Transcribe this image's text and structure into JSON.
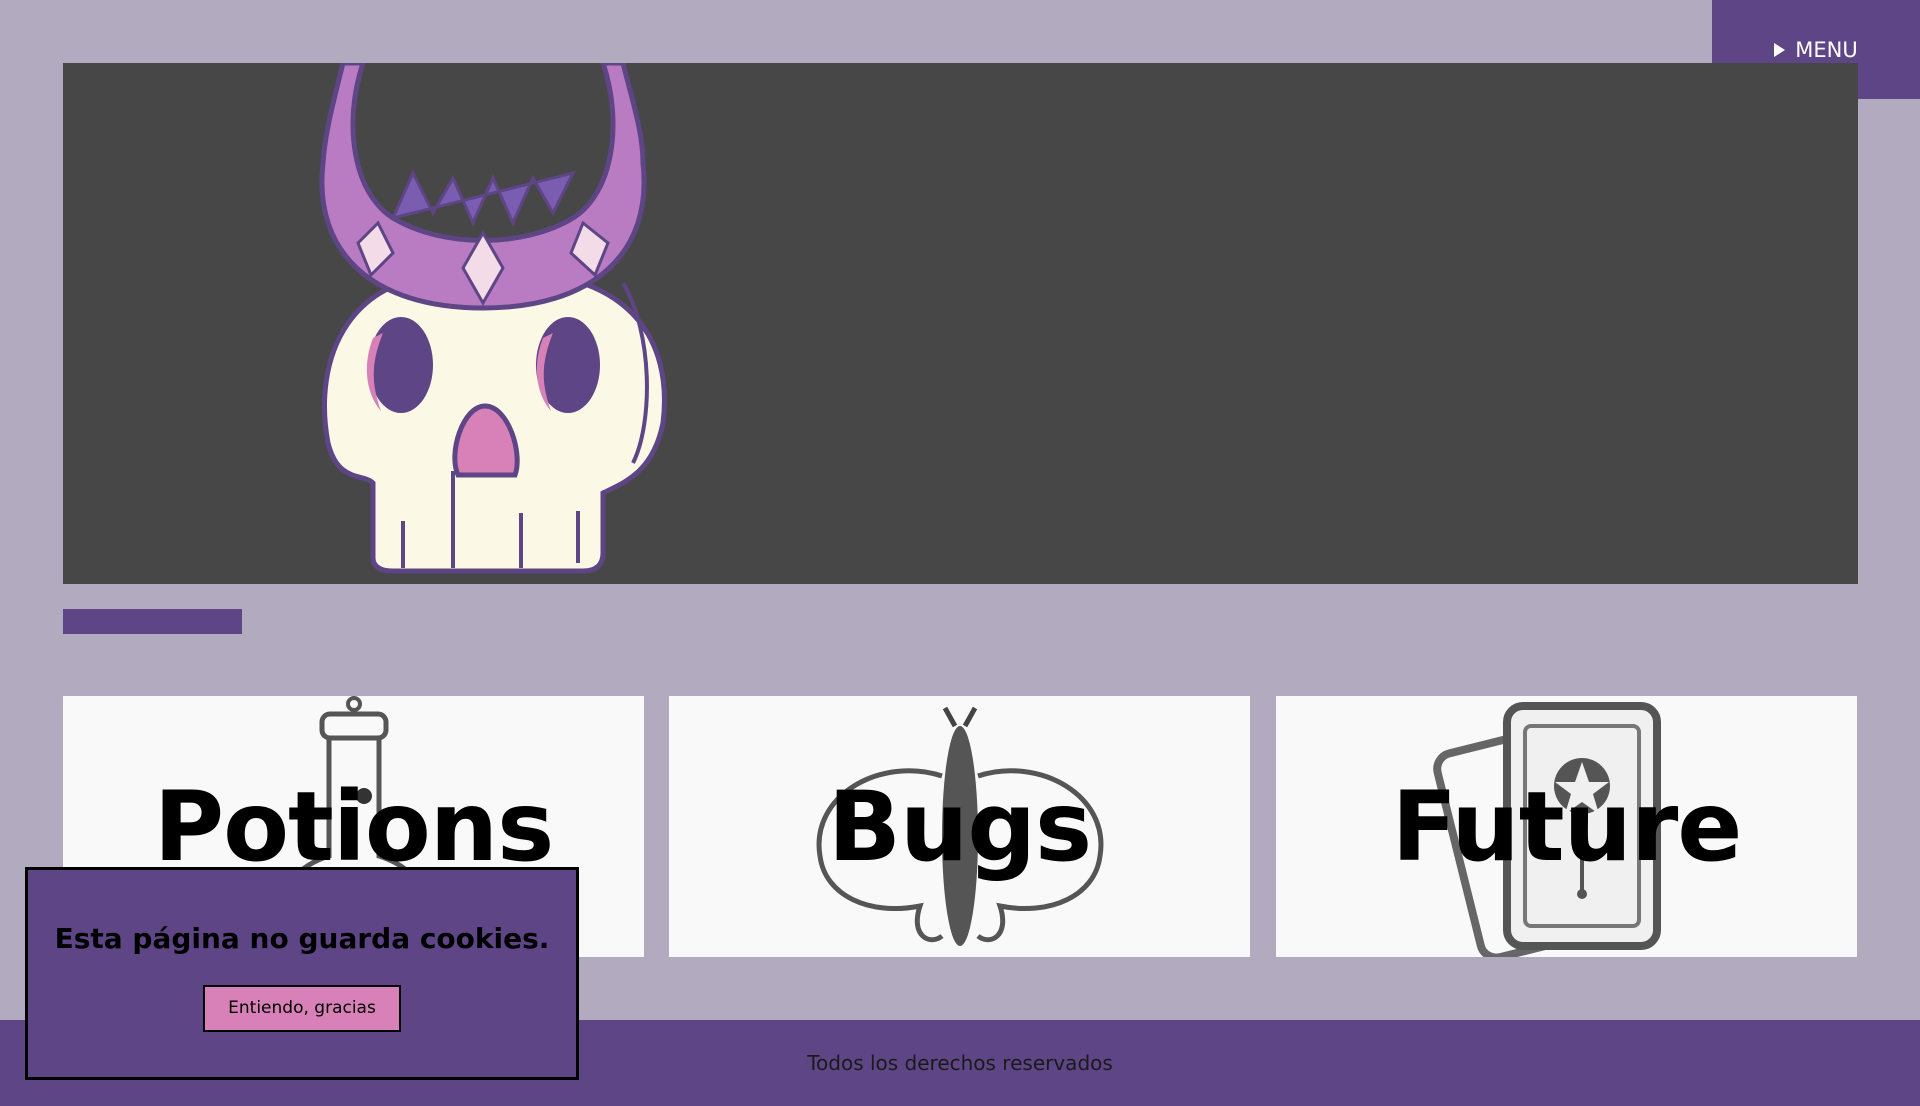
{
  "menu": {
    "label": "MENU",
    "icon": "play-triangle-icon"
  },
  "hero": {
    "image": "crowned-skull-illustration"
  },
  "cards": [
    {
      "title": "Potions",
      "icon": "potion-bottle-icon"
    },
    {
      "title": "Bugs",
      "icon": "moth-icon"
    },
    {
      "title": "Future",
      "icon": "tarot-cards-icon"
    }
  ],
  "cookie_banner": {
    "message": "Esta página no guarda cookies.",
    "button_label": "Entiendo, gracias"
  },
  "footer": {
    "text": "Todos los derechos reservados"
  },
  "colors": {
    "background": "#b2abbf",
    "accent": "#5e4585",
    "hero_bg": "#474747",
    "button_pink": "#d881b9"
  }
}
